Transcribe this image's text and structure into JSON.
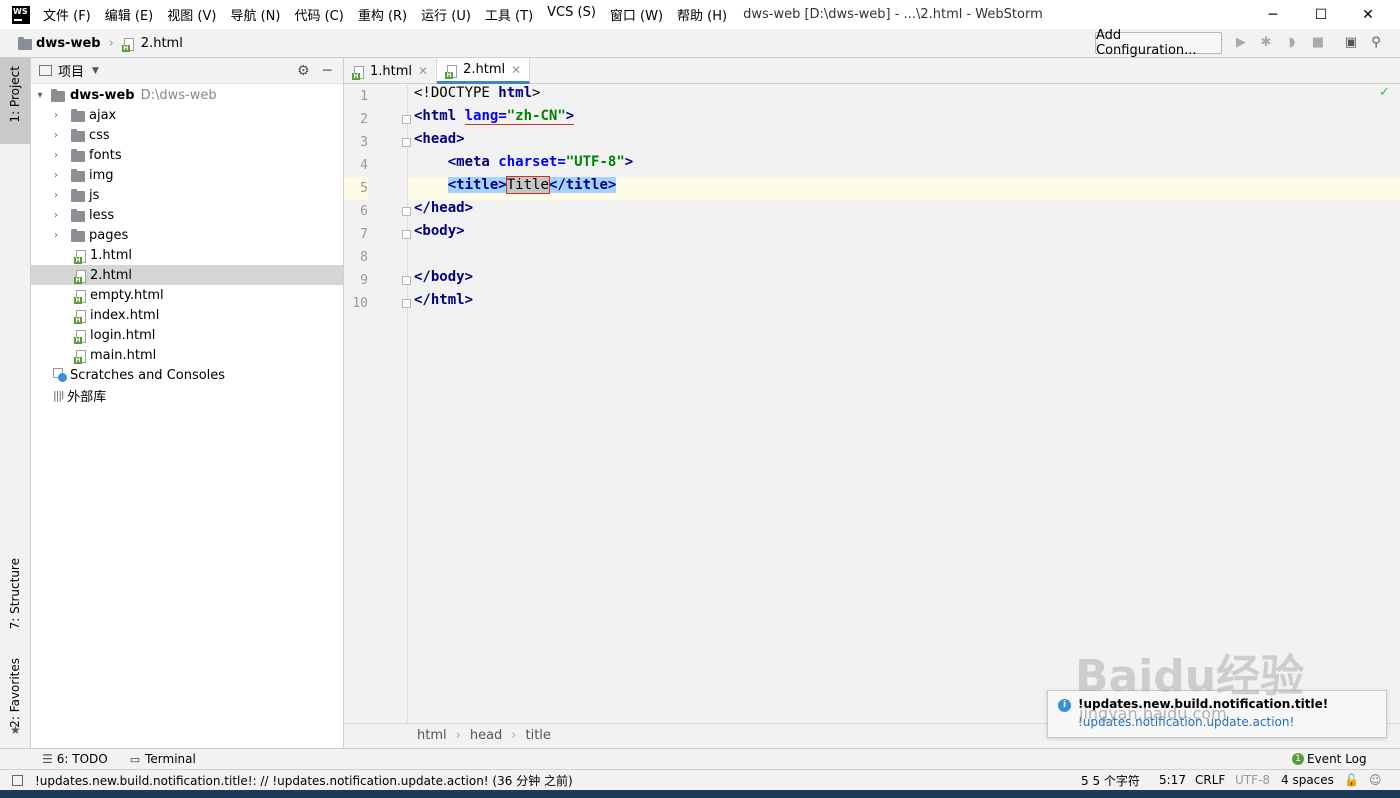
{
  "window": {
    "title": "dws-web [D:\\dws-web] - ...\\2.html - WebStorm",
    "app_icon": "WS",
    "controls": {
      "minimize": "─",
      "maximize": "☐",
      "close": "✕"
    }
  },
  "menu": [
    "文件 (F)",
    "编辑 (E)",
    "视图 (V)",
    "导航 (N)",
    "代码 (C)",
    "重构 (R)",
    "运行 (U)",
    "工具 (T)",
    "VCS (S)",
    "窗口 (W)",
    "帮助 (H)"
  ],
  "navbar": {
    "project": "dws-web",
    "file": "2.html",
    "add_configuration": "Add Configuration..."
  },
  "left_stripe": {
    "project": "1: Project",
    "structure": "7: Structure",
    "favorites": "2: Favorites"
  },
  "project_panel": {
    "title": "项目",
    "root_name": "dws-web",
    "root_path": "D:\\dws-web",
    "folders": [
      "ajax",
      "css",
      "fonts",
      "img",
      "js",
      "less",
      "pages"
    ],
    "files": [
      "1.html",
      "2.html",
      "empty.html",
      "index.html",
      "login.html",
      "main.html"
    ],
    "selected_file": "2.html",
    "scratches": "Scratches and Consoles",
    "libraries": "外部库"
  },
  "editor": {
    "tabs": [
      {
        "label": "1.html",
        "active": false
      },
      {
        "label": "2.html",
        "active": true
      }
    ],
    "line_numbers": [
      "1",
      "2",
      "3",
      "4",
      "5",
      "6",
      "7",
      "8",
      "9",
      "10"
    ],
    "current_line": 5,
    "code": {
      "l1_a": "<!DOCTYPE ",
      "l1_b": "html",
      "l1_c": ">",
      "l2_tag": "<html",
      "l2_attr": "lang",
      "l2_eq": "=",
      "l2_val": "\"zh-CN\"",
      "l2_end": ">",
      "l3": "<head>",
      "l4_tag": "<meta ",
      "l4_attr": "charset",
      "l4_eq": "=",
      "l4_val": "\"UTF-8\"",
      "l4_end": ">",
      "l5_open": "<title>",
      "l5_text": "Title",
      "l5_close": "</title>",
      "l6": "</head>",
      "l7": "<body>",
      "l9": "</body>",
      "l10": "</html>"
    },
    "breadcrumb": [
      "html",
      "head",
      "title"
    ]
  },
  "bottom_tools": {
    "todo": "6: TODO",
    "terminal": "Terminal",
    "event_log": "Event Log"
  },
  "notification": {
    "title": "!updates.new.build.notification.title!",
    "action": "!updates.notification.update.action!"
  },
  "status": {
    "message": "!updates.new.build.notification.title!: // !updates.notification.update.action! (36 分钟 之前)",
    "chars": "5 5 个字符",
    "position": "5:17",
    "line_sep": "CRLF",
    "encoding": "UTF-8",
    "indent": "4 spaces"
  },
  "watermark": {
    "line1": "Baidu经验",
    "line2": "jingyan.baidu.com"
  },
  "colors": {
    "accent": "#4083c9",
    "tag": "#000080",
    "attr": "#0000ff",
    "value": "#008000",
    "selection": "#a6d2ff"
  }
}
